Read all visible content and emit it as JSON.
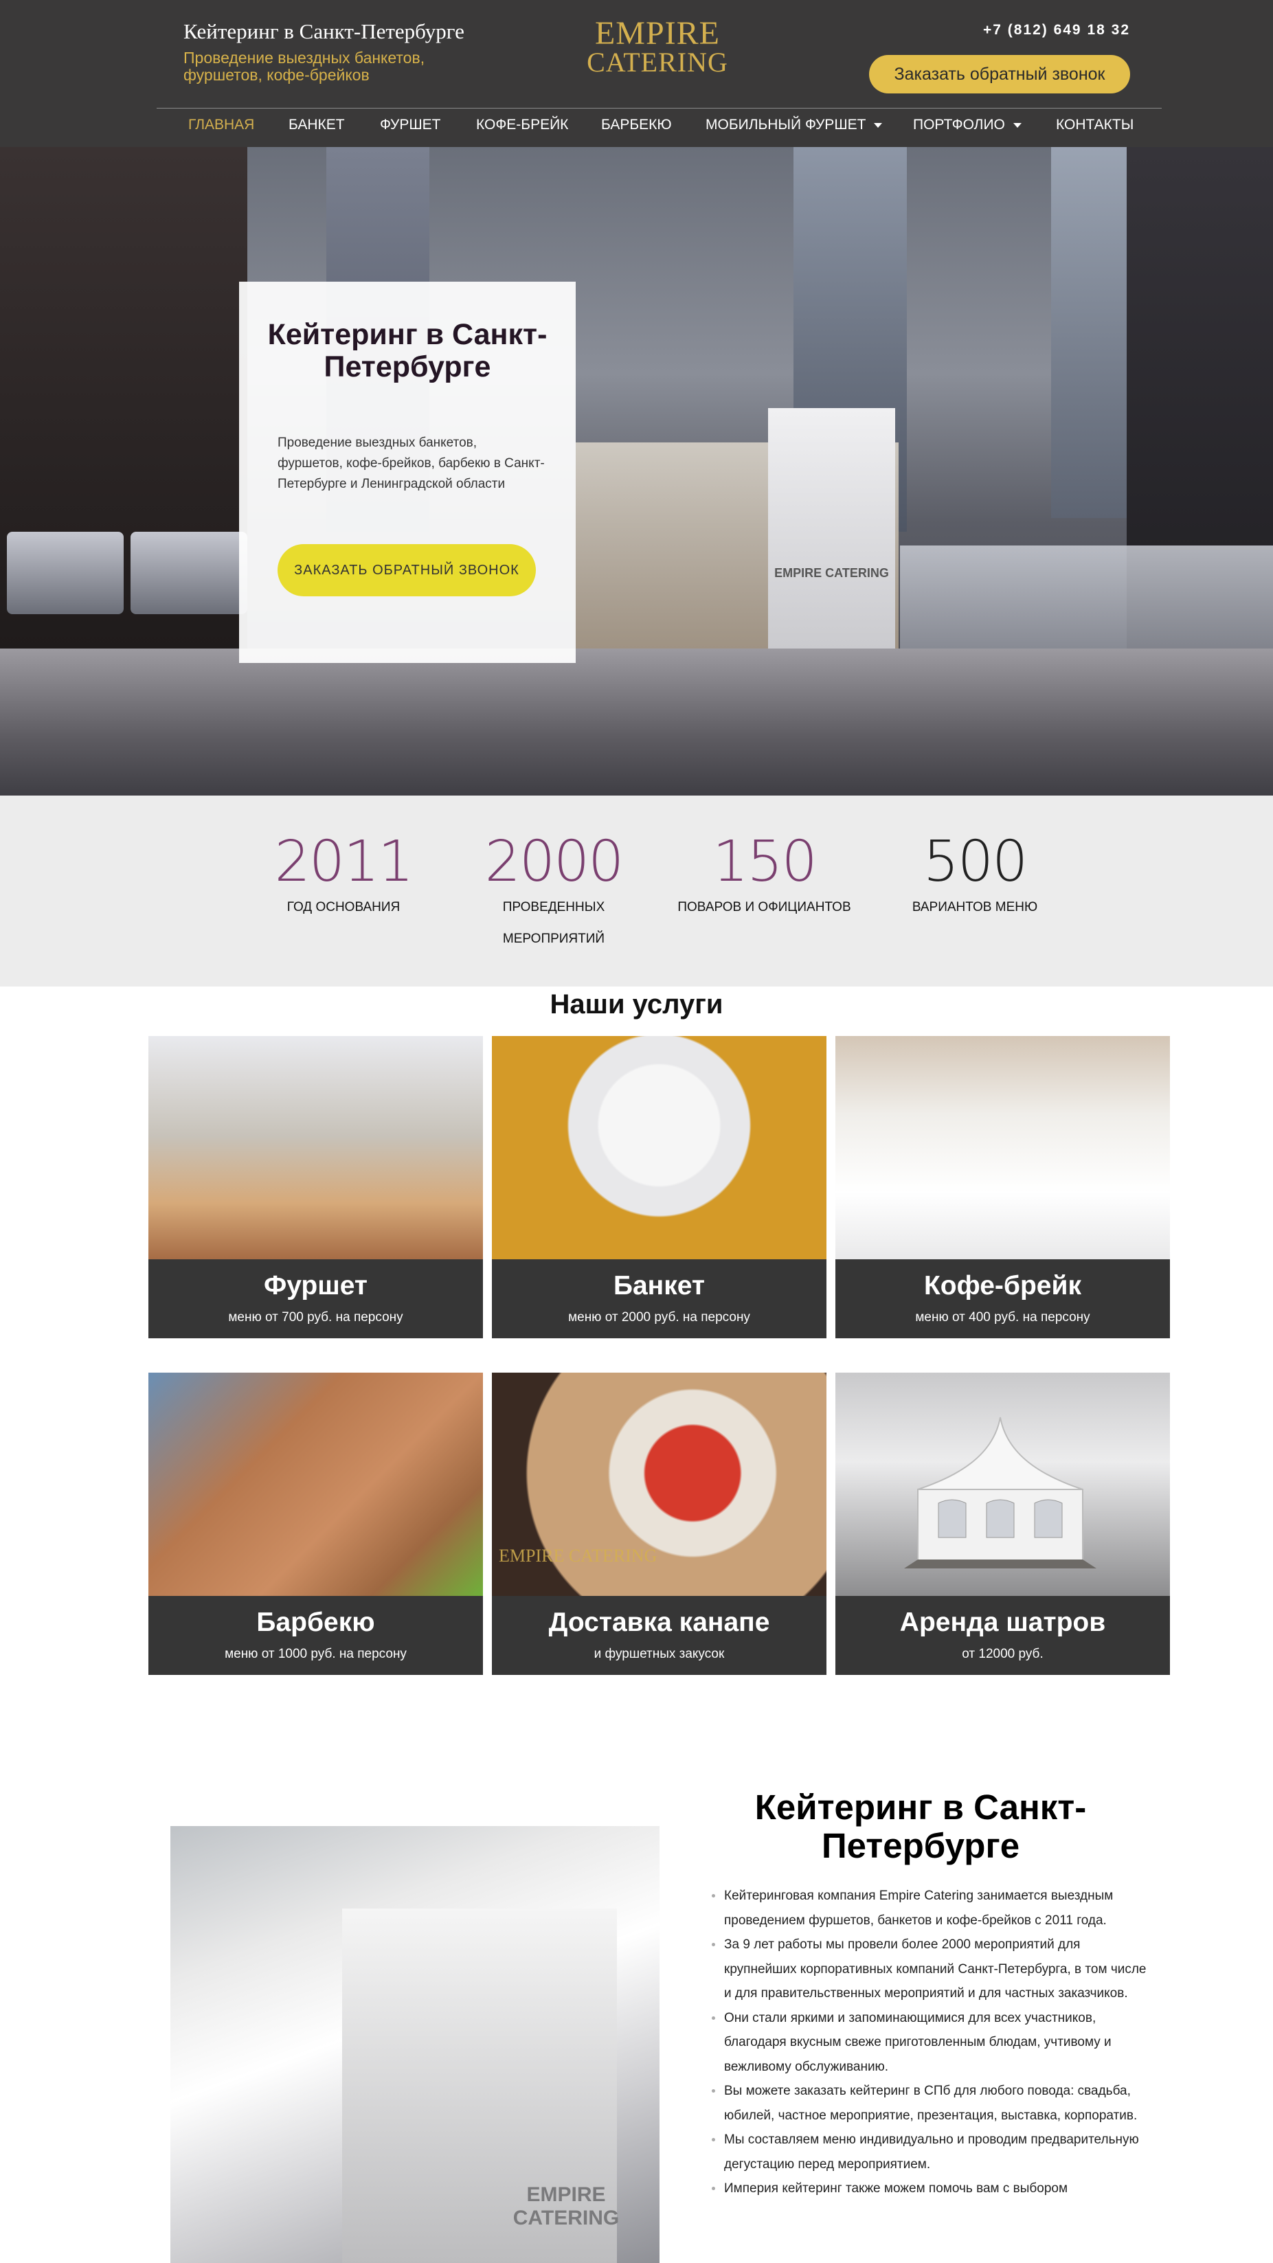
{
  "header": {
    "title": "Кейтеринг в Санкт-Петербурге",
    "subtitle": "Проведение выездных банкетов, фуршетов, кофе-брейков",
    "logo_line1": "EMPIRE",
    "logo_line2": "CATERING",
    "phone": "+7 (812) 649 18 32",
    "callback_label": "Заказать обратный звонок",
    "accent_color": "#d4b04f"
  },
  "nav": {
    "items": [
      {
        "label": "ГЛАВНАЯ",
        "active": true
      },
      {
        "label": "БАНКЕТ"
      },
      {
        "label": "ФУРШЕТ"
      },
      {
        "label": "КОФЕ-БРЕЙК"
      },
      {
        "label": "БАРБЕКЮ"
      },
      {
        "label": "МОБИЛЬНЫЙ ФУРШЕТ",
        "dropdown": true
      },
      {
        "label": "ПОРТФОЛИО",
        "dropdown": true
      },
      {
        "label": "КОНТАКТЫ"
      }
    ]
  },
  "hero": {
    "title": "Кейтеринг в Санкт-Петербурге",
    "text": "Проведение выездных банкетов, фуршетов, кофе-брейков, барбекю в Санкт-Петербурге и Ленинградской области",
    "button": "ЗАКАЗАТЬ ОБРАТНЫЙ ЗВОНОК",
    "stand_text": "EMPIRE CATERING"
  },
  "stats": [
    {
      "value": "2011",
      "label": "ГОД ОСНОВАНИЯ",
      "color": "#7a3f6f"
    },
    {
      "value": "2000",
      "label": "ПРОВЕДЕННЫХ МЕРОПРИЯТИЙ",
      "color": "#7a3f6f"
    },
    {
      "value": "150",
      "label": "ПОВАРОВ И ОФИЦИАНТОВ",
      "color": "#7a3f6f"
    },
    {
      "value": "500",
      "label": "ВАРИАНТОВ МЕНЮ",
      "color": "#222222"
    }
  ],
  "services": {
    "title": "Наши услуги",
    "items": [
      {
        "name": "Фуршет",
        "price": "меню от 700 руб. на персону"
      },
      {
        "name": "Банкет",
        "price": "меню от 2000 руб. на персону"
      },
      {
        "name": "Кофе-брейк",
        "price": "меню от 400 руб. на персону"
      },
      {
        "name": "Барбекю",
        "price": "меню от 1000 руб. на персону"
      },
      {
        "name": "Доставка канапе",
        "price": "и фуршетных закусок",
        "watermark": "EMPIRE CATERING"
      },
      {
        "name": "Аренда шатров",
        "price": "от 12000 руб."
      }
    ]
  },
  "about": {
    "title": "Кейтеринг в Санкт-Петербурге",
    "image_text": "EMPIRE CATERING",
    "points": [
      "Кейтеринговая компания Empire Catering занимается выездным проведением фуршетов, банкетов  и кофе-брейков с 2011 года.",
      "За 9 лет работы мы провели более 2000 мероприятий для крупнейших корпоративных компаний Санкт-Петербурга, в том числе и для правительственных мероприятий и для частных заказчиков.",
      "Они стали яркими и запоминающимися для всех участников, благодаря вкусным свеже приготовленным блюдам, учтивому и вежливому обслуживанию.",
      "Вы можете заказать кейтеринг в СПб для любого повода: свадьба, юбилей, частное мероприятие, презентация, выставка, корпоратив.",
      "Мы составляем меню индивидуально и проводим предварительную дегустацию перед мероприятием.",
      "Империя кейтеринг также можем помочь вам с выбором"
    ]
  }
}
